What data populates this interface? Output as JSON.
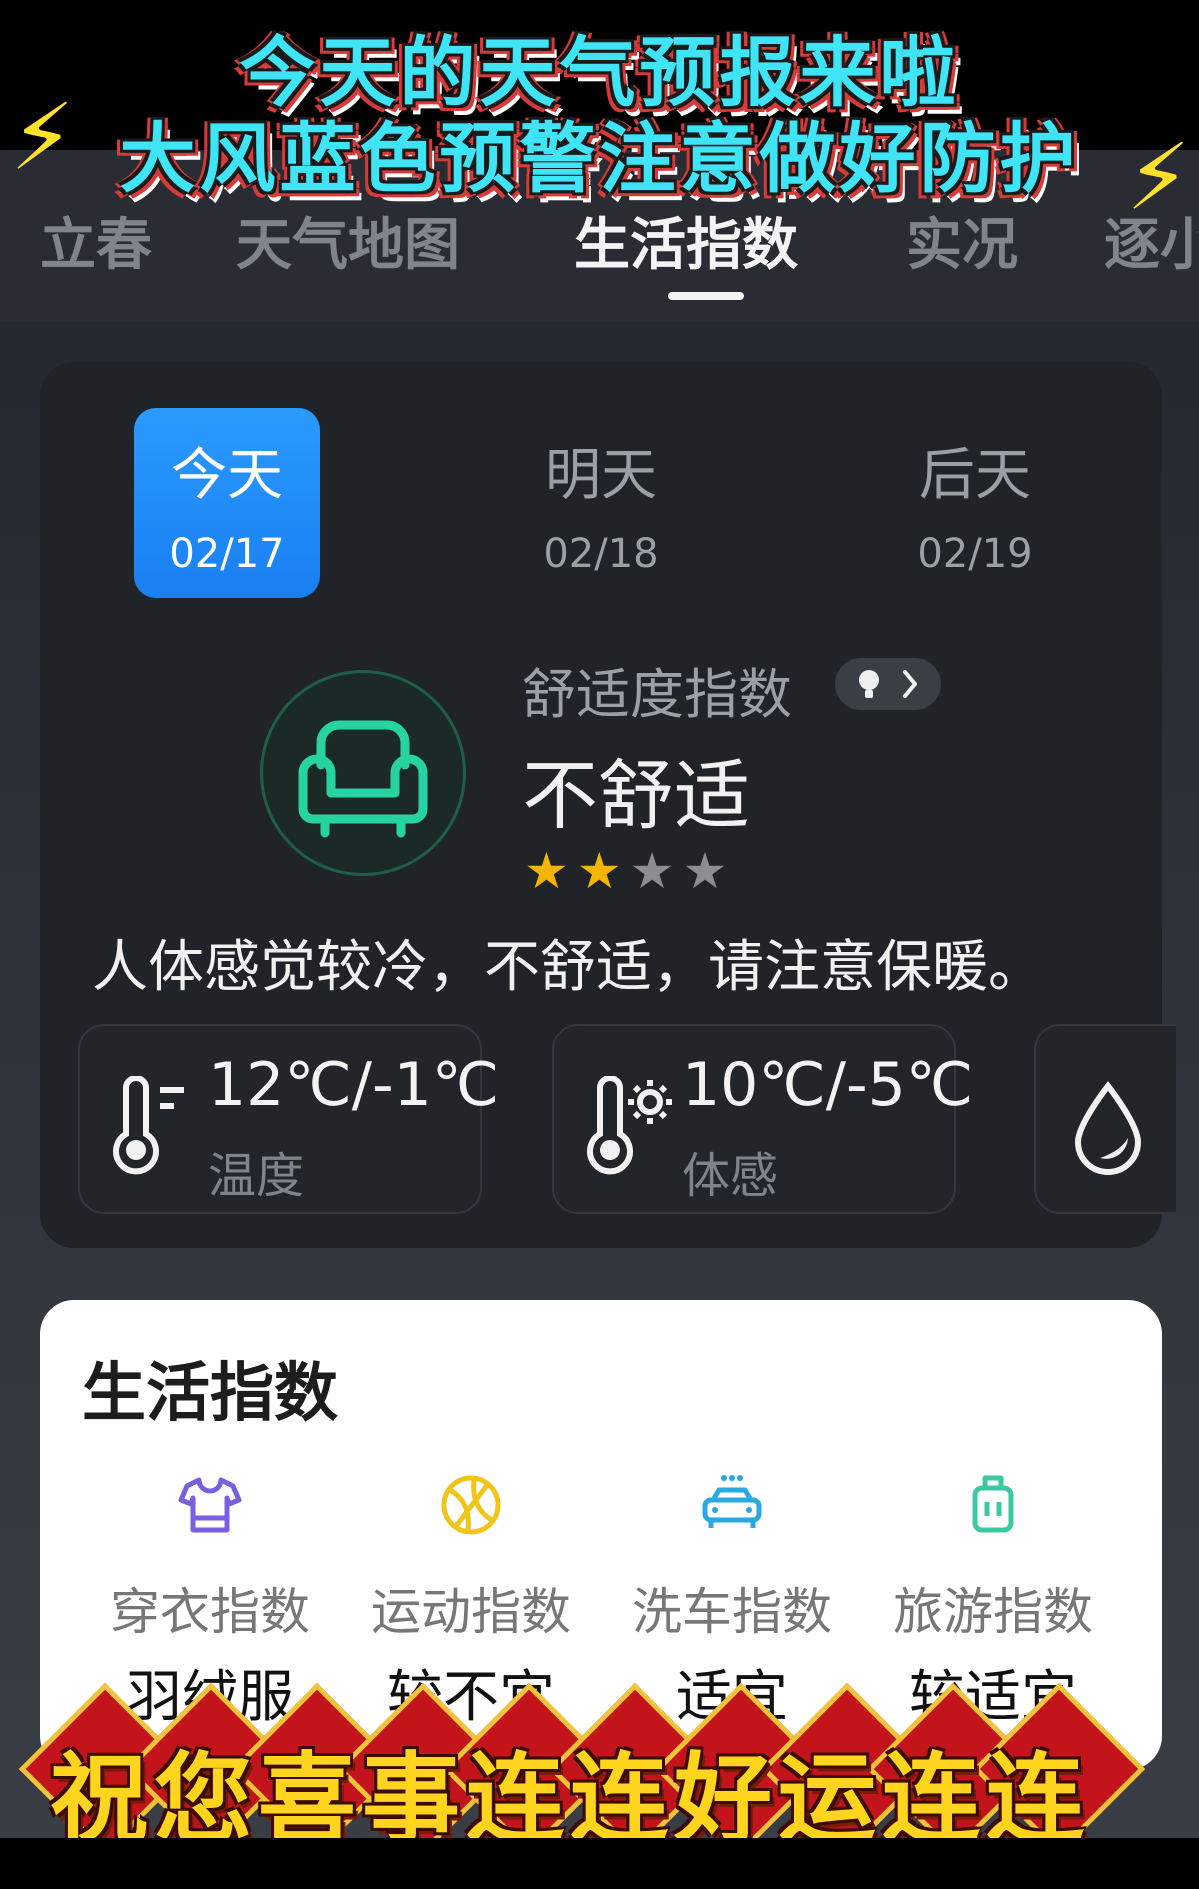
{
  "banner": {
    "line1": "今天的天气预报来啦",
    "line2": "大风蓝色预警注意做好防护",
    "bolt_icon": "lightning-icon"
  },
  "tabs": [
    {
      "label": "立春"
    },
    {
      "label": "天气地图"
    },
    {
      "label": "生活指数",
      "active": true
    },
    {
      "label": "实况"
    },
    {
      "label": "逐小"
    }
  ],
  "days": [
    {
      "name": "今天",
      "date": "02/17",
      "active": true
    },
    {
      "name": "明天",
      "date": "02/18"
    },
    {
      "name": "后天",
      "date": "02/19"
    }
  ],
  "comfort": {
    "label": "舒适度指数",
    "value": "不舒适",
    "rating": 2,
    "rating_max": 4,
    "description": "人体感觉较冷，不舒适，请注意保暖。"
  },
  "metrics": [
    {
      "value": "12℃/-1℃",
      "label": "温度",
      "icon": "thermometer-icon"
    },
    {
      "value": "10℃/-5℃",
      "label": "体感",
      "icon": "thermometer-sun-icon"
    },
    {
      "value": "",
      "label": "",
      "icon": "water-drop-icon"
    }
  ],
  "life": {
    "title": "生活指数",
    "items": [
      {
        "title": "穿衣指数",
        "value": "羽绒服",
        "icon": "shirt-icon",
        "color": "#7a5fe0"
      },
      {
        "title": "运动指数",
        "value": "较不宜",
        "icon": "ball-icon",
        "color": "#f0c419"
      },
      {
        "title": "洗车指数",
        "value": "适宜",
        "icon": "car-icon",
        "color": "#2aa8e0"
      },
      {
        "title": "旅游指数",
        "value": "较适宜",
        "icon": "luggage-icon",
        "color": "#3cc9a2"
      }
    ]
  },
  "greeting": "祝您喜事连连好运连连",
  "colors": {
    "accent": "#1a8cff",
    "star_on": "#f4b400",
    "star_off": "#8a8e93",
    "sofa": "#27d3a0"
  }
}
